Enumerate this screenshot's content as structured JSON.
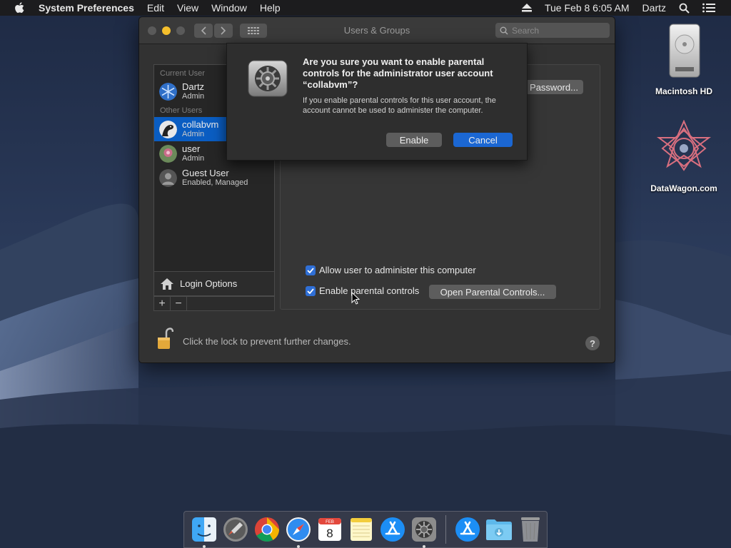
{
  "menubar": {
    "app_name": "System Preferences",
    "menus": [
      "Edit",
      "View",
      "Window",
      "Help"
    ],
    "clock": "Tue Feb 8  6:05 AM",
    "user": "Dartz"
  },
  "desktop": {
    "icons": [
      {
        "label": "Macintosh HD"
      },
      {
        "label": "DataWagon.com"
      }
    ]
  },
  "window": {
    "title": "Users & Groups",
    "search_placeholder": "Search"
  },
  "sidebar": {
    "current_header": "Current User",
    "other_header": "Other Users",
    "users": [
      {
        "name": "Dartz",
        "role": "Admin"
      },
      {
        "name": "collabvm",
        "role": "Admin"
      },
      {
        "name": "user",
        "role": "Admin"
      },
      {
        "name": "Guest User",
        "role": "Enabled, Managed"
      }
    ],
    "login_options": "Login Options",
    "add_label": "+",
    "remove_label": "−"
  },
  "panel": {
    "password_button": "Password...",
    "allow_admin": "Allow user to administer this computer",
    "enable_parental": "Enable parental controls",
    "open_parental": "Open Parental Controls..."
  },
  "footer": {
    "lock_text": "Click the lock to prevent further changes.",
    "help": "?"
  },
  "dialog": {
    "title": "Are you sure you want to enable parental controls for the administrator user account “collabvm”?",
    "message": "If you enable parental controls for this user account, the account cannot be used to administer the computer.",
    "enable": "Enable",
    "cancel": "Cancel"
  },
  "dock": {
    "calendar_month": "FEB",
    "calendar_day": "8"
  },
  "colors": {
    "selection": "#0a5dc2",
    "accent": "#1b67d3",
    "traffic_close": "#5a5a5a",
    "traffic_min": "#f5bf2c",
    "traffic_max": "#5a5a5a"
  }
}
